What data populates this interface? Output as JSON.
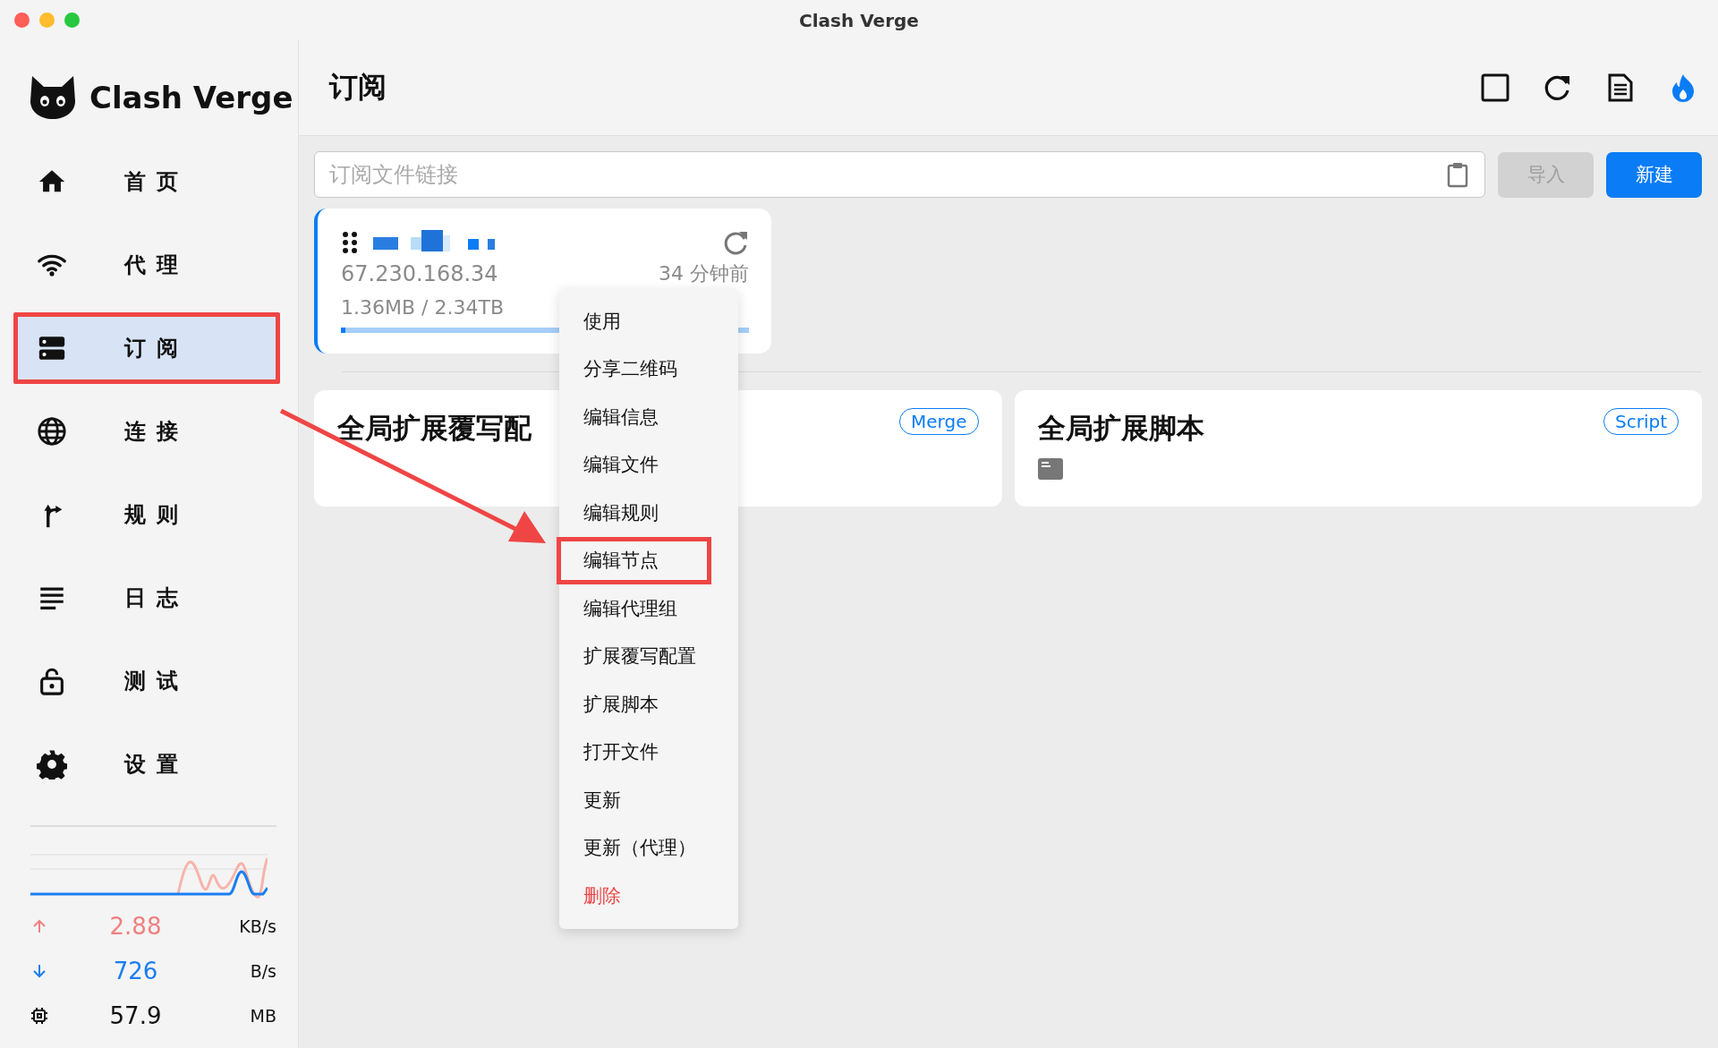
{
  "window": {
    "title": "Clash Verge"
  },
  "app": {
    "name": "Clash Verge"
  },
  "nav": [
    {
      "label": "首页",
      "selected": false,
      "highlighted": false
    },
    {
      "label": "代理",
      "selected": false,
      "highlighted": false
    },
    {
      "label": "订阅",
      "selected": true,
      "highlighted": true
    },
    {
      "label": "连接",
      "selected": false,
      "highlighted": false
    },
    {
      "label": "规则",
      "selected": false,
      "highlighted": false
    },
    {
      "label": "日志",
      "selected": false,
      "highlighted": false
    },
    {
      "label": "测试",
      "selected": false,
      "highlighted": false
    },
    {
      "label": "设置",
      "selected": false,
      "highlighted": false
    }
  ],
  "traffic": [
    {
      "kind": "upload",
      "value": "2.88",
      "unit": "KB/s"
    },
    {
      "kind": "download",
      "value": "726",
      "unit": "B/s"
    },
    {
      "kind": "memory",
      "value": "57.9",
      "unit": "MB"
    }
  ],
  "page": {
    "title": "订阅"
  },
  "import_bar": {
    "placeholder": "订阅文件链接",
    "buttons": [
      {
        "label": "导入",
        "disabled": true
      },
      {
        "label": "新建",
        "disabled": false
      }
    ]
  },
  "profile": {
    "host": "67.230.168.34",
    "updated": "34 分钟前",
    "usage": "1.36MB / 2.34TB",
    "level": 0.01,
    "selected": true
  },
  "extensions": [
    {
      "title": "全局扩展覆写配",
      "tag": "Merge",
      "kind": "merge"
    },
    {
      "title": "全局扩展脚本",
      "tag": "Script",
      "kind": "script"
    }
  ],
  "context_menu": {
    "items": [
      {
        "label": "使用",
        "danger": false,
        "highlighted": false
      },
      {
        "label": "分享二维码",
        "danger": false,
        "highlighted": false
      },
      {
        "label": "编辑信息",
        "danger": false,
        "highlighted": false
      },
      {
        "label": "编辑文件",
        "danger": false,
        "highlighted": false
      },
      {
        "label": "编辑规则",
        "danger": false,
        "highlighted": false
      },
      {
        "label": "编辑节点",
        "danger": false,
        "highlighted": true
      },
      {
        "label": "编辑代理组",
        "danger": false,
        "highlighted": false
      },
      {
        "label": "扩展覆写配置",
        "danger": false,
        "highlighted": false
      },
      {
        "label": "扩展脚本",
        "danger": false,
        "highlighted": false
      },
      {
        "label": "打开文件",
        "danger": false,
        "highlighted": false
      },
      {
        "label": "更新",
        "danger": false,
        "highlighted": false
      },
      {
        "label": "更新（代理）",
        "danger": false,
        "highlighted": false
      },
      {
        "label": "删除",
        "danger": true,
        "highlighted": false
      }
    ]
  }
}
